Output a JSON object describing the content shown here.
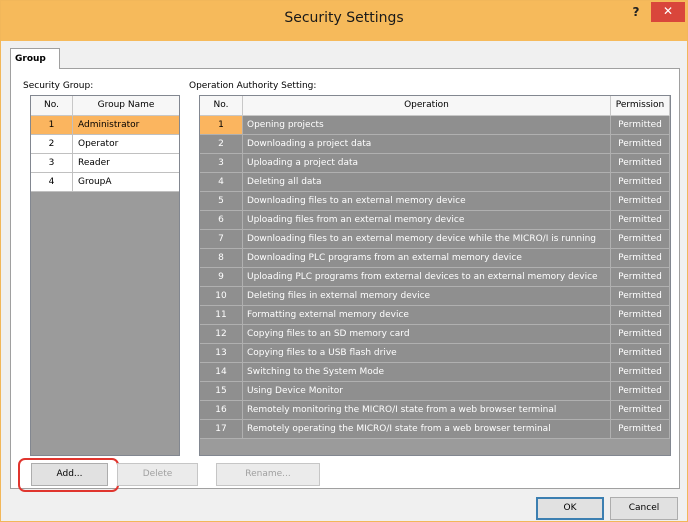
{
  "window": {
    "title": "Security Settings",
    "help_glyph": "?",
    "close_glyph": "✕"
  },
  "tab": {
    "label": "Group"
  },
  "security_group": {
    "label": "Security Group:",
    "columns": [
      "No.",
      "Group Name"
    ],
    "rows": [
      {
        "no": "1",
        "name": "Administrator",
        "selected": true
      },
      {
        "no": "2",
        "name": "Operator",
        "selected": false
      },
      {
        "no": "3",
        "name": "Reader",
        "selected": false
      },
      {
        "no": "4",
        "name": "GroupA",
        "selected": false
      }
    ]
  },
  "operation_authority": {
    "label": "Operation Authority Setting:",
    "columns": [
      "No.",
      "Operation",
      "Permission"
    ],
    "rows": [
      {
        "no": "1",
        "operation": "Opening projects",
        "permission": "Permitted"
      },
      {
        "no": "2",
        "operation": "Downloading a project data",
        "permission": "Permitted"
      },
      {
        "no": "3",
        "operation": "Uploading a project data",
        "permission": "Permitted"
      },
      {
        "no": "4",
        "operation": "Deleting all data",
        "permission": "Permitted"
      },
      {
        "no": "5",
        "operation": "Downloading files to an external memory device",
        "permission": "Permitted"
      },
      {
        "no": "6",
        "operation": "Uploading files from an external memory device",
        "permission": "Permitted"
      },
      {
        "no": "7",
        "operation": "Downloading files to an external memory device while the MICRO/I is running",
        "permission": "Permitted"
      },
      {
        "no": "8",
        "operation": "Downloading PLC programs from an external memory device",
        "permission": "Permitted"
      },
      {
        "no": "9",
        "operation": "Uploading PLC programs from external devices to an external memory device",
        "permission": "Permitted"
      },
      {
        "no": "10",
        "operation": "Deleting files in external memory device",
        "permission": "Permitted"
      },
      {
        "no": "11",
        "operation": "Formatting external memory device",
        "permission": "Permitted"
      },
      {
        "no": "12",
        "operation": "Copying files to an SD memory card",
        "permission": "Permitted"
      },
      {
        "no": "13",
        "operation": "Copying files to a USB flash drive",
        "permission": "Permitted"
      },
      {
        "no": "14",
        "operation": "Switching to the System Mode",
        "permission": "Permitted"
      },
      {
        "no": "15",
        "operation": "Using Device Monitor",
        "permission": "Permitted"
      },
      {
        "no": "16",
        "operation": "Remotely monitoring the MICRO/I state from a web browser terminal",
        "permission": "Permitted"
      },
      {
        "no": "17",
        "operation": "Remotely operating the MICRO/I state from a web browser terminal",
        "permission": "Permitted"
      }
    ]
  },
  "buttons": {
    "add": "Add...",
    "delete": "Delete",
    "rename": "Rename...",
    "ok": "OK",
    "cancel": "Cancel"
  },
  "colors": {
    "title_bar": "#f6ba5b",
    "selected_row": "#fbb55f",
    "grid_background": "#9b9b9b",
    "close_button": "#d9463b",
    "highlight_ring": "#e0352e"
  }
}
